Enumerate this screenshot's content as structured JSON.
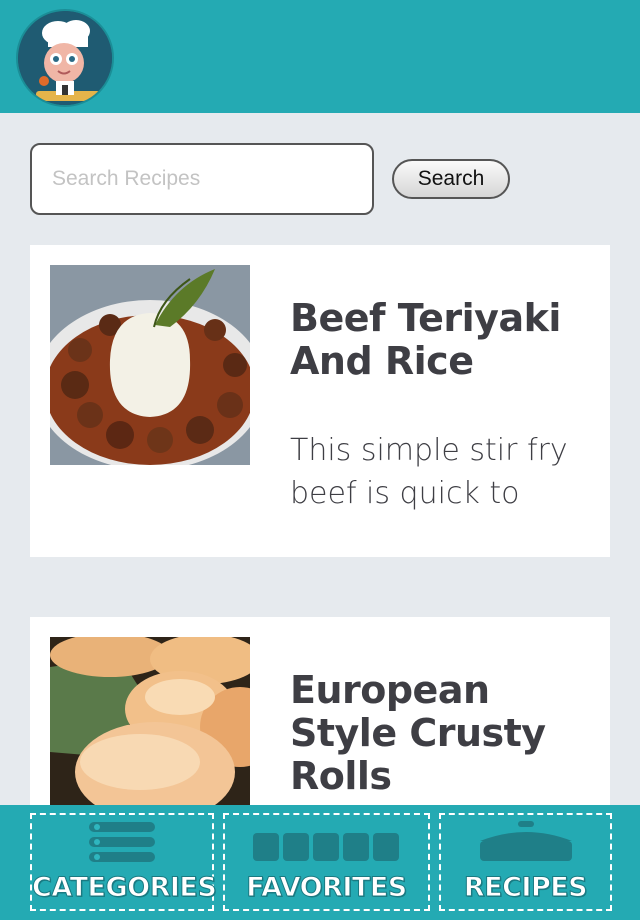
{
  "search": {
    "placeholder": "Search Recipes",
    "button_label": "Search"
  },
  "recipes": [
    {
      "title": "Beef Teriyaki And Rice",
      "description": "This simple stir fry beef is quick to make and goes well with rice."
    },
    {
      "title": "European Style Crusty Rolls",
      "description": ""
    }
  ],
  "tabs": [
    {
      "label": "CATEGORIES",
      "icon": "categories-icon"
    },
    {
      "label": "FAVORITES",
      "icon": "favorites-icon"
    },
    {
      "label": "RECIPES",
      "icon": "recipes-icon"
    }
  ],
  "colors": {
    "accent": "#24aab3",
    "background": "#e6eaee",
    "text": "#3e3e44",
    "icon": "#1f7f88"
  }
}
